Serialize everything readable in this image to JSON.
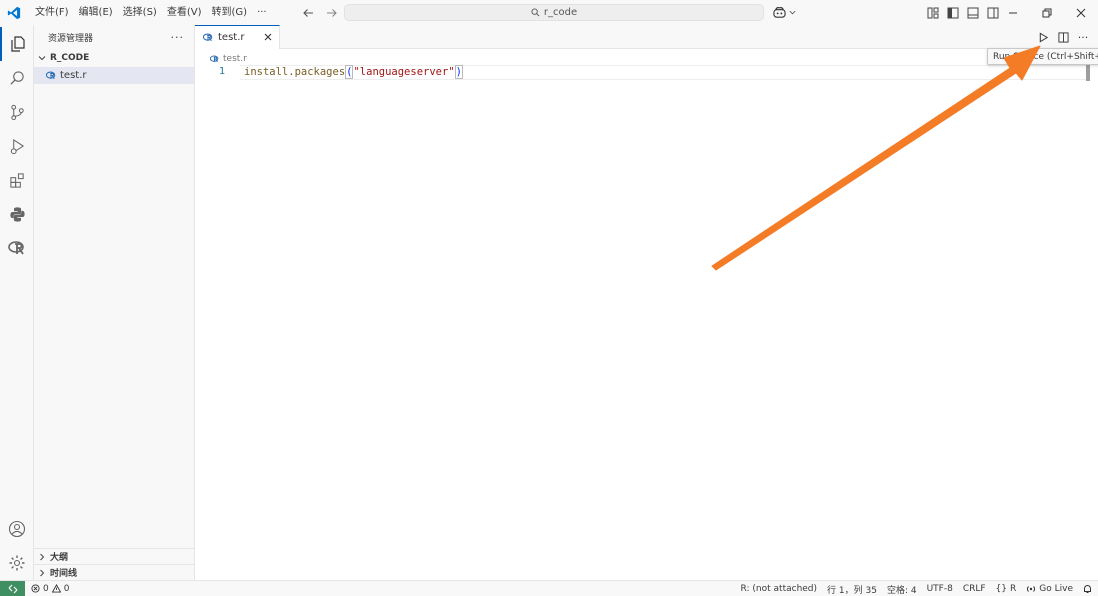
{
  "titlebar": {
    "menu": [
      "文件(F)",
      "编辑(E)",
      "选择(S)",
      "查看(V)",
      "转到(G)",
      "···"
    ],
    "search_text": "r_code"
  },
  "sidebar": {
    "title": "资源管理器",
    "folder": "R_CODE",
    "files": [
      "test.r"
    ],
    "sections": [
      "大纲",
      "时间线"
    ]
  },
  "editor": {
    "tab_label": "test.r",
    "breadcrumb": "test.r",
    "line_number": "1",
    "code": {
      "fn": "install.packages",
      "open": "(",
      "str": "\"languageserver\"",
      "close": ")"
    },
    "tooltip": "Run Source (Ctrl+Shift+S)"
  },
  "statusbar": {
    "errors": "0",
    "warnings": "0",
    "r_status": "R: (not attached)",
    "position": "行 1，列 35",
    "indent": "空格: 4",
    "encoding": "UTF-8",
    "eol": "CRLF",
    "language": "R",
    "golive": "Go Live"
  },
  "colors": {
    "accent": "#005fb8",
    "arrow": "#f47c27",
    "remote": "#3f8f63"
  }
}
